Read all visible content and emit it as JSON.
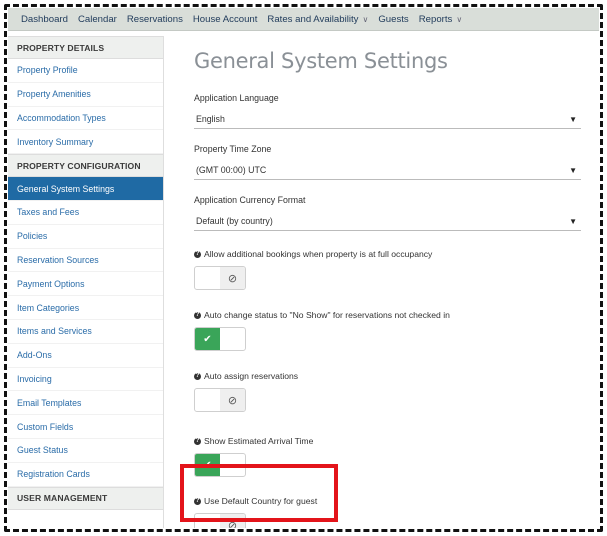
{
  "topnav": {
    "items": [
      "Dashboard",
      "Calendar",
      "Reservations",
      "House Account",
      "Rates and Availability",
      "Guests",
      "Reports"
    ]
  },
  "sidebar": {
    "property_details": "PROPERTY DETAILS",
    "details_items": [
      "Property Profile",
      "Property Amenities",
      "Accommodation Types",
      "Inventory Summary"
    ],
    "property_configuration": "PROPERTY CONFIGURATION",
    "config_items": [
      "General System Settings",
      "Taxes and Fees",
      "Policies",
      "Reservation Sources",
      "Payment Options",
      "Item Categories",
      "Items and Services",
      "Add-Ons",
      "Invoicing",
      "Email Templates",
      "Custom Fields",
      "Guest Status",
      "Registration Cards"
    ],
    "user_management": "USER MANAGEMENT"
  },
  "main": {
    "title": "General System Settings",
    "language": {
      "label": "Application Language",
      "value": "English"
    },
    "timezone": {
      "label": "Property Time Zone",
      "value": "(GMT 00:00) UTC"
    },
    "currency": {
      "label": "Application Currency Format",
      "value": "Default (by country)"
    },
    "options": [
      {
        "label": "Allow additional bookings when property is at full occupancy",
        "state": "off"
      },
      {
        "label": "Auto change status to \"No Show\" for reservations not checked in",
        "state": "on"
      },
      {
        "label": "Auto assign reservations",
        "state": "off"
      },
      {
        "label": "Show Estimated Arrival Time",
        "state": "on"
      },
      {
        "label": "Use Default Country for guest",
        "state": "off"
      }
    ]
  },
  "colors": {
    "accent": "#1f6aa4",
    "toggle_on": "#3aa559",
    "highlight": "#e3141a"
  },
  "icons": {
    "question": "question-circle-icon",
    "check": "check-icon",
    "off": "ban-icon",
    "dropdown": "caret-down-icon"
  }
}
